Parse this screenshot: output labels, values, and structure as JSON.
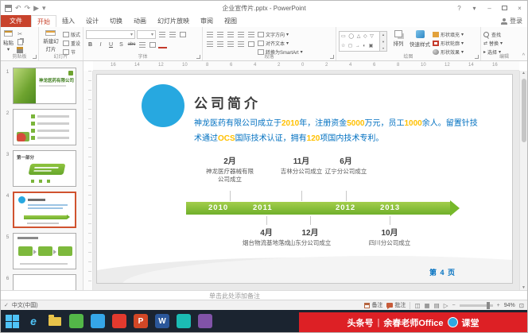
{
  "titlebar": {
    "title": "企业宣传片.pptx - PowerPoint",
    "signin": "登录"
  },
  "tabs": [
    {
      "label": "文件"
    },
    {
      "label": "开始"
    },
    {
      "label": "插入"
    },
    {
      "label": "设计"
    },
    {
      "label": "切换"
    },
    {
      "label": "动画"
    },
    {
      "label": "幻灯片放映"
    },
    {
      "label": "审阅"
    },
    {
      "label": "视图"
    }
  ],
  "ribbon": {
    "groups": [
      "剪贴板",
      "幻灯片",
      "字体",
      "段落",
      "绘图",
      "编辑"
    ],
    "paste": "粘贴",
    "new_slide": "新建幻灯片",
    "layout": "版式",
    "reset": "重设",
    "section": "节",
    "text_direction": "文字方向",
    "align_text": "对齐文本",
    "convert_smartart": "转换为SmartArt",
    "arrange": "排列",
    "quick_styles": "快速样式",
    "shape_fill": "形状填充",
    "shape_outline": "形状轮廓",
    "shape_effects": "形状效果",
    "find": "查找",
    "replace": "替换",
    "select": "选择"
  },
  "icons": {
    "dropdown": "▾",
    "undo": "↶",
    "redo": "↷",
    "play": "▶",
    "help": "?",
    "minimize": "–",
    "close": "×",
    "collapse": "^",
    "check": "✓",
    "scissors": "✂",
    "bold": "B",
    "italic": "I",
    "underline": "U",
    "shadow": "S",
    "strike": "abc",
    "swap": "⇄",
    "select_arrow": "▸",
    "shapes1": "▭ ◯ △ ◇ ▽",
    "shapes2": "☆ ◻ → ◐ ▣",
    "scroll_up": "▲",
    "scroll_down": "▼",
    "view_normal": "◫",
    "view_sorter": "▦",
    "view_reading": "▤",
    "view_slideshow": "▷",
    "zoom_out": "−",
    "zoom_in": "+",
    "fit": "⊡",
    "ie": "e",
    "word": "W",
    "ppt": "P"
  },
  "ruler": {
    "numbers": [
      "16",
      "14",
      "12",
      "10",
      "8",
      "6",
      "4",
      "2",
      "0",
      "2",
      "4",
      "6",
      "8",
      "10",
      "12",
      "14",
      "16"
    ]
  },
  "thumbnails": [
    {
      "num": "1",
      "title": "神龙医药有限公司"
    },
    {
      "num": "2"
    },
    {
      "num": "3",
      "title": "第一部分"
    },
    {
      "num": "4"
    },
    {
      "num": "5"
    },
    {
      "num": "6"
    }
  ],
  "slide": {
    "title": "公司简介",
    "body_segments": [
      {
        "text": "神龙医药有限公司成立于"
      },
      {
        "text": "2010"
      },
      {
        "text": "年，注册资金"
      },
      {
        "text": "5000"
      },
      {
        "text": "万元，员工"
      },
      {
        "text": "1000"
      },
      {
        "text": "余人。"
      },
      {
        "text": "留置针技术通过"
      },
      {
        "text": "OCS"
      },
      {
        "text": "国际技术认证，拥有"
      },
      {
        "text": "120"
      },
      {
        "text": "项国内技术专利。"
      }
    ],
    "timeline_years": [
      "2010",
      "2011",
      "2012",
      "2013"
    ],
    "milestones_top": [
      {
        "month": "2月",
        "text": "神龙医疗器械有限公司成立"
      },
      {
        "month": "11月",
        "text": "吉林分公司成立"
      },
      {
        "month": "6月",
        "text": "辽宁分公司成立"
      }
    ],
    "milestones_bottom": [
      {
        "month": "4月",
        "text": "烟台物流基地落成"
      },
      {
        "month": "12月",
        "text": "山东分公司成立"
      },
      {
        "month": "10月",
        "text": "四川分公司成立"
      }
    ],
    "page_label": "第 4 页"
  },
  "notes": {
    "placeholder": "单击此处添加备注"
  },
  "statusbar": {
    "language": "中文(中国)",
    "notes_btn": "备注",
    "comments_btn": "批注",
    "zoom": "94%"
  },
  "banner": {
    "prefix": "头条号",
    "divider": "|",
    "name": "余春老师Office",
    "suffix": "课堂"
  },
  "colors": {
    "accent": "#C8432C",
    "slide_blue": "#27A8E0",
    "text_blue": "#0070C0",
    "highlight": "#FFC000",
    "green": "#76B82A"
  }
}
